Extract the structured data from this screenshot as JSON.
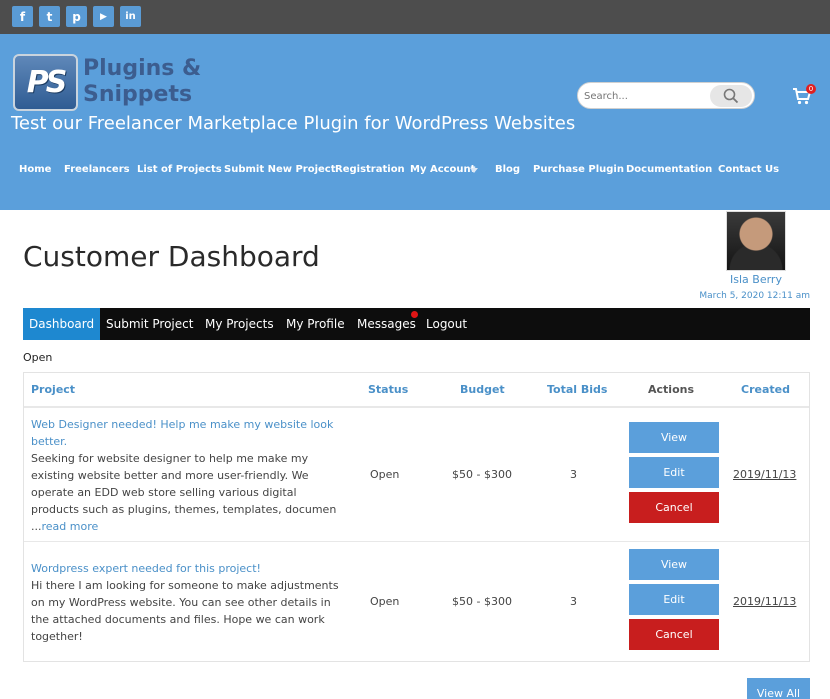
{
  "social": {
    "facebook_glyph": "f",
    "twitter_glyph": "t",
    "pinterest_glyph": "p",
    "youtube_glyph": "▶",
    "linkedin_glyph": "in",
    "icons": [
      "facebook-icon",
      "twitter-icon",
      "pinterest-icon",
      "youtube-icon",
      "linkedin-icon"
    ]
  },
  "header": {
    "logo_mark": "PS",
    "logo_line1": "Plugins &",
    "logo_line2": "Snippets",
    "tagline": "Test our Freelancer Marketplace Plugin for WordPress Websites",
    "search_placeholder": "Search...",
    "cart_count": "0"
  },
  "nav": {
    "items": [
      "Home",
      "Freelancers",
      "List of Projects",
      "Submit New Project",
      "Registration",
      "My Account",
      "Blog",
      "Purchase Plugin",
      "Documentation",
      "Contact Us"
    ]
  },
  "page": {
    "title": "Customer Dashboard",
    "user_name": "Isla Berry",
    "user_date": "March 5, 2020 12:11 am"
  },
  "tabs": [
    "Dashboard",
    "Submit Project",
    "My Projects",
    "My Profile",
    "Messages",
    "Logout"
  ],
  "filter": {
    "status": "Open"
  },
  "table": {
    "headers": [
      "Project",
      "Status",
      "Budget",
      "Total Bids",
      "Actions",
      "Created"
    ],
    "rows": [
      {
        "title_line1": "Web Designer needed! Help me make my website look",
        "title_line2": "better.",
        "desc_lines": [
          "Seeking for website designer to help me make my",
          "existing website better and more user-friendly. We",
          "operate an EDD web store selling various digital",
          "products such as plugins, themes, templates, documen"
        ],
        "desc_prefix": "...",
        "read_more": "read more",
        "status": "Open",
        "budget": "$50 - $300",
        "bids": "3",
        "view": "View",
        "edit": "Edit",
        "cancel": "Cancel",
        "created": "2019/11/13"
      },
      {
        "title_line1": "Wordpress expert needed for this project!",
        "desc_lines": [
          "Hi there I am looking for someone to make adjustments",
          "on my WordPress website. You can see other details in",
          "the attached documents and files. Hope we can work",
          "together!"
        ],
        "status": "Open",
        "budget": "$50 - $300",
        "bids": "3",
        "view": "View",
        "edit": "Edit",
        "cancel": "Cancel",
        "created": "2019/11/13"
      }
    ]
  },
  "view_all": "View All",
  "colors": {
    "header_blue": "#5b9fdb",
    "tab_active": "#1e88d0",
    "link_blue": "#4a90c8",
    "cancel_red": "#c81e1e",
    "topbar": "#4d4d4d"
  }
}
